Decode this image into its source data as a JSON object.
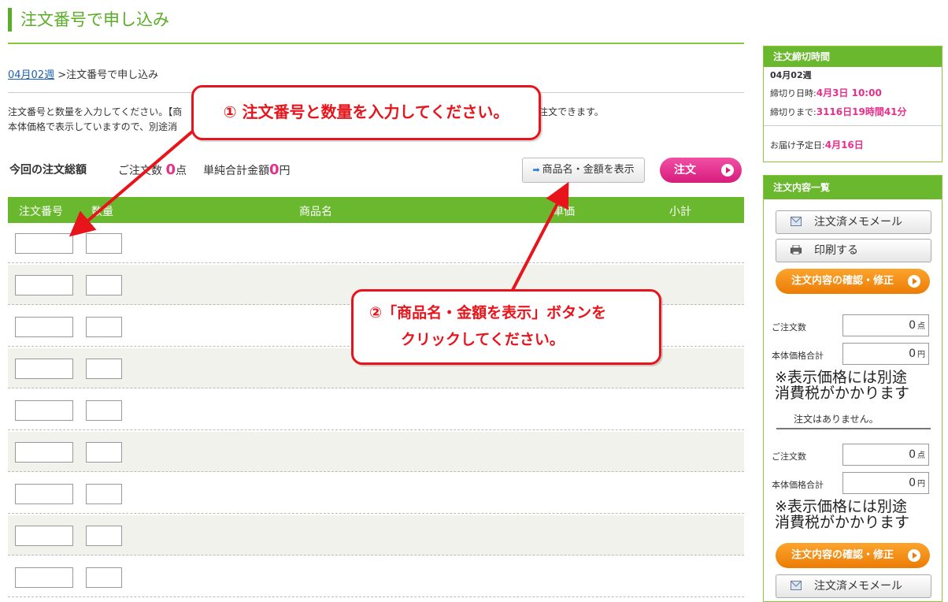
{
  "header": {
    "title": "注文番号で申し込み"
  },
  "breadcrumb": {
    "link": "04月02週",
    "separator": ">",
    "current": "注文番号で申し込み"
  },
  "description": {
    "line1_left": "注文番号と数量を入力してください。【商",
    "line1_right": "注文できます。",
    "line2_left": "本体価格で表示していますので、別途消"
  },
  "summary": {
    "label": "今回の注文総額",
    "count_label": "ご注文数",
    "count_value": "0",
    "count_unit": "点",
    "total_label": "単純合計金額",
    "total_value": "0",
    "total_unit": "円",
    "show_button": "商品名・金額を表示",
    "order_button": "注文"
  },
  "table": {
    "headers": [
      "注文番号",
      "数量",
      "商品名",
      "単価",
      "小計"
    ],
    "row_count": 9
  },
  "deadline": {
    "header": "注文締切時間",
    "week": "04月02週",
    "deadline_label": "締切り日時:",
    "deadline_value": "4月3日 10:00",
    "remaining_label": "締切りまで:",
    "remaining_value": "3116日19時間41分",
    "delivery_label": "お届け予定日:",
    "delivery_value": "4月16日"
  },
  "order_list": {
    "header": "注文内容一覧",
    "memo_mail_button": "注文済メモメール",
    "print_button": "印刷する",
    "confirm_button": "注文内容の確認・修正",
    "count_label": "ご注文数",
    "count_value": "0",
    "count_unit": "点",
    "price_label": "本体価格合計",
    "price_value": "0",
    "price_unit": "円",
    "tax_note_1": "※表示価格には別途",
    "tax_note_2": "消費税がかかります",
    "no_orders": "注文はありません。"
  },
  "callouts": {
    "step1": "① 注文番号と数量を入力してください。",
    "step2_line1": "②「商品名・金額を表示」ボタンを",
    "step2_line2": "クリックしてください。"
  },
  "colors": {
    "brand_green": "#6ab82e",
    "accent_pink": "#e62e8b",
    "orange": "#ec7c06",
    "callout_red": "#e8141b"
  }
}
